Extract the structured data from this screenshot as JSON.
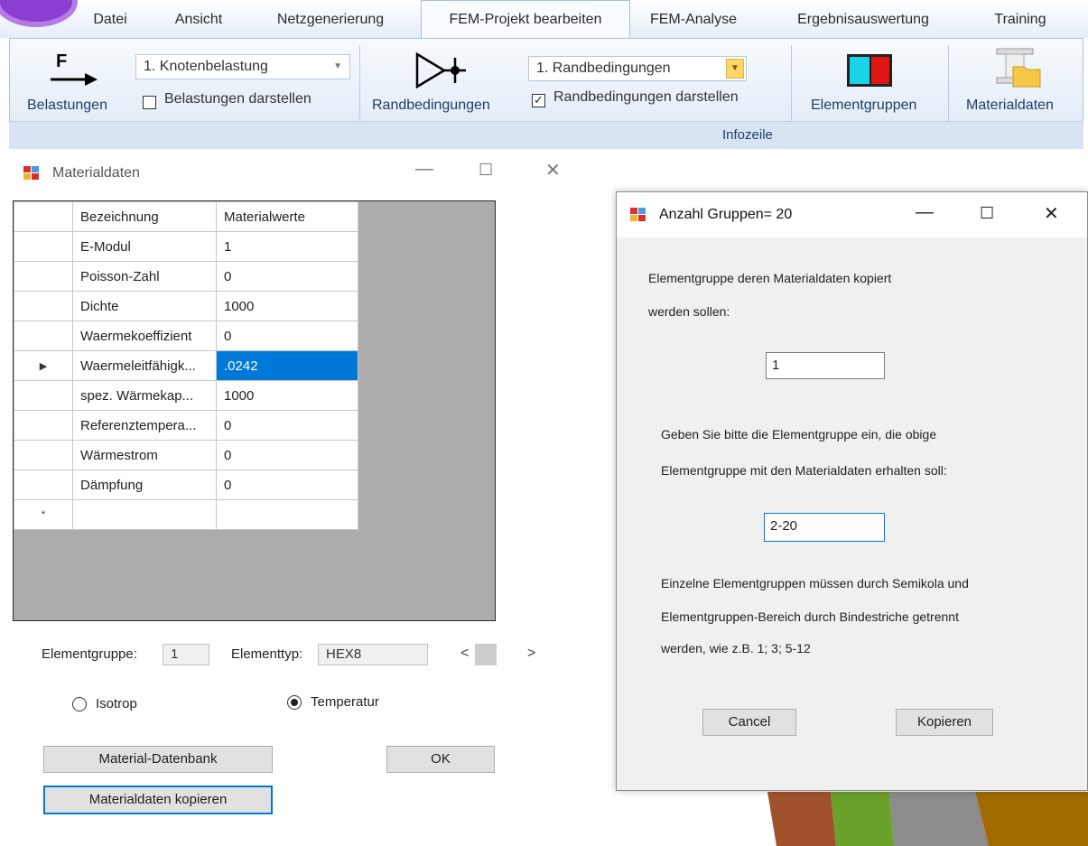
{
  "ribbon": {
    "tabs": [
      "Datei",
      "Ansicht",
      "Netzgenerierung",
      "FEM-Projekt bearbeiten",
      "FEM-Analyse",
      "Ergebnisauswertung",
      "Training"
    ],
    "active_tab": "FEM-Projekt bearbeiten",
    "belastungen_label": "Belastungen",
    "load_icon_letter": "F",
    "load_combo_value": "1.  Knotenbelastung",
    "load_show_checkbox_label": "Belastungen darstellen",
    "load_show_checked": false,
    "rand_label": "Randbedingungen",
    "rand_combo_value": "1.  Randbedingungen",
    "rand_show_checkbox_label": "Randbedingungen darstellen",
    "rand_show_checked": true,
    "elementgruppen_label": "Elementgruppen",
    "materialdaten_label": "Materialdaten",
    "infozeile_label": "Infozeile",
    "colors": {
      "accent": "#0078d7",
      "ribbon_bg": "#dde8f5"
    }
  },
  "material_window": {
    "title": "Materialdaten",
    "columns": [
      "Bezeichnung",
      "Materialwerte"
    ],
    "rows": [
      {
        "name": "E-Modul",
        "value": "1"
      },
      {
        "name": "Poisson-Zahl",
        "value": "0"
      },
      {
        "name": "Dichte",
        "value": "1000"
      },
      {
        "name": "Waermekoeffizient",
        "value": "0"
      },
      {
        "name": "Waermeleitfähigk...",
        "value": ".0242"
      },
      {
        "name": "spez. Wärmekap...",
        "value": "1000"
      },
      {
        "name": "Referenztempera...",
        "value": "0"
      },
      {
        "name": "Wärmestrom",
        "value": "0"
      },
      {
        "name": "Dämpfung",
        "value": "0"
      }
    ],
    "selected_row": 4,
    "new_row_marker": "*",
    "current_row_marker": "▶",
    "elementgruppe_label": "Elementgruppe:",
    "elementgruppe_value": "1",
    "elementtyp_label": "Elementtyp:",
    "elementtyp_value": "HEX8",
    "radio_isotrop": "Isotrop",
    "radio_temperatur": "Temperatur",
    "radio_selected": "Temperatur",
    "btn_datenbank": "Material-Datenbank",
    "btn_ok": "OK",
    "btn_kopieren": "Materialdaten kopieren"
  },
  "copy_dialog": {
    "title": "Anzahl Gruppen=  20",
    "text1": "Elementgruppe deren Materialdaten kopiert",
    "text2": "werden sollen:",
    "source_value": "1",
    "text3": "Geben Sie bitte die Elementgruppe ein, die obige",
    "text4": "Elementgruppe mit den Materialdaten erhalten soll:",
    "target_value": "2-20",
    "text5": "Einzelne Elementgruppen müssen durch Semikola und",
    "text6": "Elementgruppen-Bereich durch Bindestriche getrennt",
    "text7": "werden, wie z.B. 1; 3; 5-12",
    "btn_cancel": "Cancel",
    "btn_kopieren": "Kopieren"
  },
  "background_colors": [
    "#a0522d",
    "#6aa12a",
    "#8c8c8c",
    "#a06a00"
  ]
}
